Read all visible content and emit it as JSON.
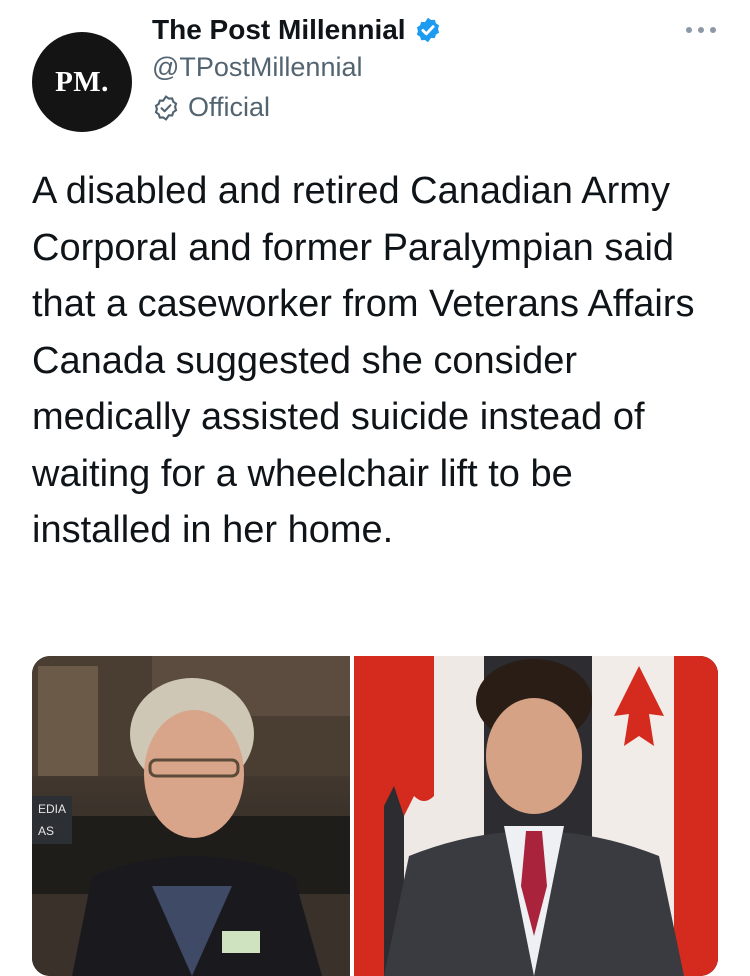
{
  "account": {
    "avatar_text": "PM.",
    "display_name": "The Post Millennial",
    "handle": "@TPostMillennial",
    "label": "Official"
  },
  "tweet": {
    "text": "A disabled and retired Canadian Army Corporal and former Paralympian said that a caseworker from Veterans Affairs Canada suggested she consider medically assisted suicide instead of waiting for a wheelchair lift to be installed in her home."
  },
  "media": {
    "left_panel_label": "EDIA AS"
  },
  "icons": {
    "verified": "verified-badge-icon",
    "official": "official-badge-icon",
    "more": "more-options-icon"
  },
  "colors": {
    "verified_blue": "#1d9bf0",
    "secondary_text": "#536471",
    "primary_text": "#0f1419",
    "canada_red": "#d52b1e"
  }
}
